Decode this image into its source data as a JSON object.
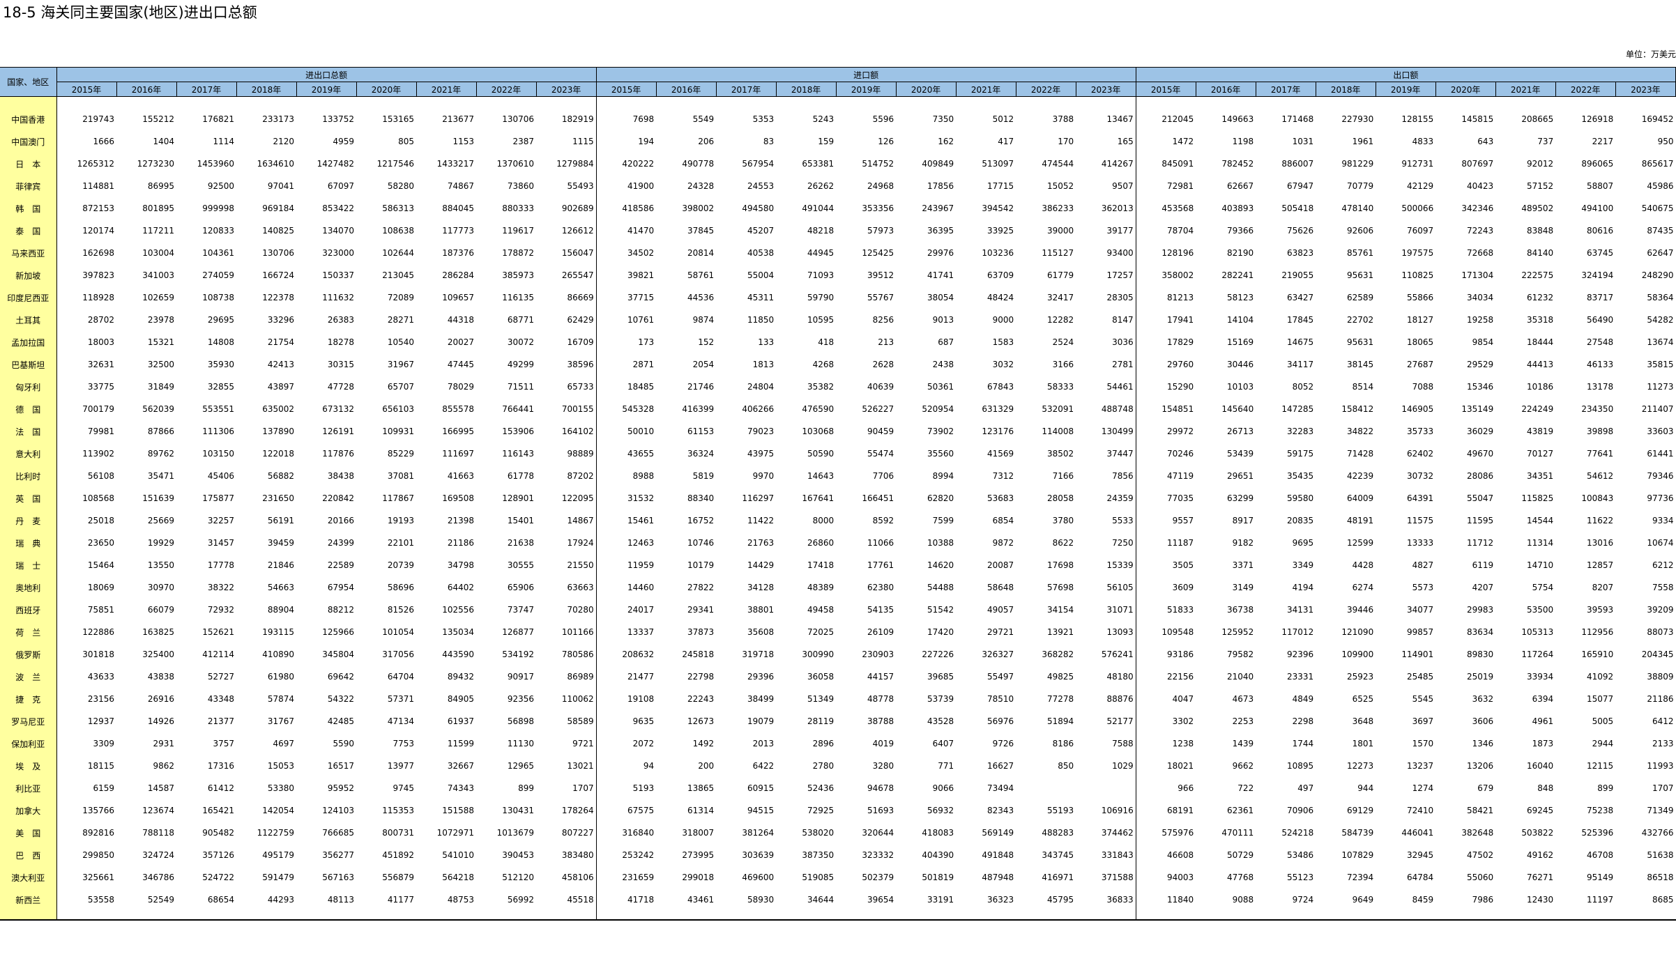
{
  "title": "18-5  海关同主要国家(地区)进出口总额",
  "unit": "单位：万美元",
  "header": {
    "row_label": "国家、地区",
    "groups": [
      "进出口总额",
      "进口额",
      "出口额"
    ],
    "years": [
      "2015年",
      "2016年",
      "2017年",
      "2018年",
      "2019年",
      "2020年",
      "2021年",
      "2022年",
      "2023年"
    ]
  },
  "rows": [
    {
      "name": "中国香港",
      "values": [
        "219743",
        "155212",
        "176821",
        "233173",
        "133752",
        "153165",
        "213677",
        "130706",
        "182919",
        "7698",
        "5549",
        "5353",
        "5243",
        "5596",
        "7350",
        "5012",
        "3788",
        "13467",
        "212045",
        "149663",
        "171468",
        "227930",
        "128155",
        "145815",
        "208665",
        "126918",
        "169452"
      ]
    },
    {
      "name": "中国澳门",
      "values": [
        "1666",
        "1404",
        "1114",
        "2120",
        "4959",
        "805",
        "1153",
        "2387",
        "1115",
        "194",
        "206",
        "83",
        "159",
        "126",
        "162",
        "417",
        "170",
        "165",
        "1472",
        "1198",
        "1031",
        "1961",
        "4833",
        "643",
        "737",
        "2217",
        "950"
      ]
    },
    {
      "name": "日　本",
      "values": [
        "1265312",
        "1273230",
        "1453960",
        "1634610",
        "1427482",
        "1217546",
        "1433217",
        "1370610",
        "1279884",
        "420222",
        "490778",
        "567954",
        "653381",
        "514752",
        "409849",
        "513097",
        "474544",
        "414267",
        "845091",
        "782452",
        "886007",
        "981229",
        "912731",
        "807697",
        "92012",
        "896065",
        "865617"
      ]
    },
    {
      "name": "菲律宾",
      "values": [
        "114881",
        "86995",
        "92500",
        "97041",
        "67097",
        "58280",
        "74867",
        "73860",
        "55493",
        "41900",
        "24328",
        "24553",
        "26262",
        "24968",
        "17856",
        "17715",
        "15052",
        "9507",
        "72981",
        "62667",
        "67947",
        "70779",
        "42129",
        "40423",
        "57152",
        "58807",
        "45986"
      ]
    },
    {
      "name": "韩　国",
      "values": [
        "872153",
        "801895",
        "999998",
        "969184",
        "853422",
        "586313",
        "884045",
        "880333",
        "902689",
        "418586",
        "398002",
        "494580",
        "491044",
        "353356",
        "243967",
        "394542",
        "386233",
        "362013",
        "453568",
        "403893",
        "505418",
        "478140",
        "500066",
        "342346",
        "489502",
        "494100",
        "540675"
      ]
    },
    {
      "name": "泰　国",
      "values": [
        "120174",
        "117211",
        "120833",
        "140825",
        "134070",
        "108638",
        "117773",
        "119617",
        "126612",
        "41470",
        "37845",
        "45207",
        "48218",
        "57973",
        "36395",
        "33925",
        "39000",
        "39177",
        "78704",
        "79366",
        "75626",
        "92606",
        "76097",
        "72243",
        "83848",
        "80616",
        "87435"
      ]
    },
    {
      "name": "马来西亚",
      "values": [
        "162698",
        "103004",
        "104361",
        "130706",
        "323000",
        "102644",
        "187376",
        "178872",
        "156047",
        "34502",
        "20814",
        "40538",
        "44945",
        "125425",
        "29976",
        "103236",
        "115127",
        "93400",
        "128196",
        "82190",
        "63823",
        "85761",
        "197575",
        "72668",
        "84140",
        "63745",
        "62647"
      ]
    },
    {
      "name": "新加坡",
      "values": [
        "397823",
        "341003",
        "274059",
        "166724",
        "150337",
        "213045",
        "286284",
        "385973",
        "265547",
        "39821",
        "58761",
        "55004",
        "71093",
        "39512",
        "41741",
        "63709",
        "61779",
        "17257",
        "358002",
        "282241",
        "219055",
        "95631",
        "110825",
        "171304",
        "222575",
        "324194",
        "248290"
      ]
    },
    {
      "name": "印度尼西亚",
      "values": [
        "118928",
        "102659",
        "108738",
        "122378",
        "111632",
        "72089",
        "109657",
        "116135",
        "86669",
        "37715",
        "44536",
        "45311",
        "59790",
        "55767",
        "38054",
        "48424",
        "32417",
        "28305",
        "81213",
        "58123",
        "63427",
        "62589",
        "55866",
        "34034",
        "61232",
        "83717",
        "58364"
      ]
    },
    {
      "name": "土耳其",
      "values": [
        "28702",
        "23978",
        "29695",
        "33296",
        "26383",
        "28271",
        "44318",
        "68771",
        "62429",
        "10761",
        "9874",
        "11850",
        "10595",
        "8256",
        "9013",
        "9000",
        "12282",
        "8147",
        "17941",
        "14104",
        "17845",
        "22702",
        "18127",
        "19258",
        "35318",
        "56490",
        "54282"
      ]
    },
    {
      "name": "孟加拉国",
      "values": [
        "18003",
        "15321",
        "14808",
        "21754",
        "18278",
        "10540",
        "20027",
        "30072",
        "16709",
        "173",
        "152",
        "133",
        "418",
        "213",
        "687",
        "1583",
        "2524",
        "3036",
        "17829",
        "15169",
        "14675",
        "95631",
        "18065",
        "9854",
        "18444",
        "27548",
        "13674"
      ]
    },
    {
      "name": "巴基斯坦",
      "values": [
        "32631",
        "32500",
        "35930",
        "42413",
        "30315",
        "31967",
        "47445",
        "49299",
        "38596",
        "2871",
        "2054",
        "1813",
        "4268",
        "2628",
        "2438",
        "3032",
        "3166",
        "2781",
        "29760",
        "30446",
        "34117",
        "38145",
        "27687",
        "29529",
        "44413",
        "46133",
        "35815"
      ]
    },
    {
      "name": "匈牙利",
      "values": [
        "33775",
        "31849",
        "32855",
        "43897",
        "47728",
        "65707",
        "78029",
        "71511",
        "65733",
        "18485",
        "21746",
        "24804",
        "35382",
        "40639",
        "50361",
        "67843",
        "58333",
        "54461",
        "15290",
        "10103",
        "8052",
        "8514",
        "7088",
        "15346",
        "10186",
        "13178",
        "11273"
      ]
    },
    {
      "name": "德　国",
      "values": [
        "700179",
        "562039",
        "553551",
        "635002",
        "673132",
        "656103",
        "855578",
        "766441",
        "700155",
        "545328",
        "416399",
        "406266",
        "476590",
        "526227",
        "520954",
        "631329",
        "532091",
        "488748",
        "154851",
        "145640",
        "147285",
        "158412",
        "146905",
        "135149",
        "224249",
        "234350",
        "211407"
      ]
    },
    {
      "name": "法　国",
      "values": [
        "79981",
        "87866",
        "111306",
        "137890",
        "126191",
        "109931",
        "166995",
        "153906",
        "164102",
        "50010",
        "61153",
        "79023",
        "103068",
        "90459",
        "73902",
        "123176",
        "114008",
        "130499",
        "29972",
        "26713",
        "32283",
        "34822",
        "35733",
        "36029",
        "43819",
        "39898",
        "33603"
      ]
    },
    {
      "name": "意大利",
      "values": [
        "113902",
        "89762",
        "103150",
        "122018",
        "117876",
        "85229",
        "111697",
        "116143",
        "98889",
        "43655",
        "36324",
        "43975",
        "50590",
        "55474",
        "35560",
        "41569",
        "38502",
        "37447",
        "70246",
        "53439",
        "59175",
        "71428",
        "62402",
        "49670",
        "70127",
        "77641",
        "61441"
      ]
    },
    {
      "name": "比利时",
      "values": [
        "56108",
        "35471",
        "45406",
        "56882",
        "38438",
        "37081",
        "41663",
        "61778",
        "87202",
        "8988",
        "5819",
        "9970",
        "14643",
        "7706",
        "8994",
        "7312",
        "7166",
        "7856",
        "47119",
        "29651",
        "35435",
        "42239",
        "30732",
        "28086",
        "34351",
        "54612",
        "79346"
      ]
    },
    {
      "name": "英　国",
      "values": [
        "108568",
        "151639",
        "175877",
        "231650",
        "220842",
        "117867",
        "169508",
        "128901",
        "122095",
        "31532",
        "88340",
        "116297",
        "167641",
        "166451",
        "62820",
        "53683",
        "28058",
        "24359",
        "77035",
        "63299",
        "59580",
        "64009",
        "64391",
        "55047",
        "115825",
        "100843",
        "97736"
      ]
    },
    {
      "name": "丹　麦",
      "values": [
        "25018",
        "25669",
        "32257",
        "56191",
        "20166",
        "19193",
        "21398",
        "15401",
        "14867",
        "15461",
        "16752",
        "11422",
        "8000",
        "8592",
        "7599",
        "6854",
        "3780",
        "5533",
        "9557",
        "8917",
        "20835",
        "48191",
        "11575",
        "11595",
        "14544",
        "11622",
        "9334"
      ]
    },
    {
      "name": "瑞　典",
      "values": [
        "23650",
        "19929",
        "31457",
        "39459",
        "24399",
        "22101",
        "21186",
        "21638",
        "17924",
        "12463",
        "10746",
        "21763",
        "26860",
        "11066",
        "10388",
        "9872",
        "8622",
        "7250",
        "11187",
        "9182",
        "9695",
        "12599",
        "13333",
        "11712",
        "11314",
        "13016",
        "10674"
      ]
    },
    {
      "name": "瑞　士",
      "values": [
        "15464",
        "13550",
        "17778",
        "21846",
        "22589",
        "20739",
        "34798",
        "30555",
        "21550",
        "11959",
        "10179",
        "14429",
        "17418",
        "17761",
        "14620",
        "20087",
        "17698",
        "15339",
        "3505",
        "3371",
        "3349",
        "4428",
        "4827",
        "6119",
        "14710",
        "12857",
        "6212"
      ]
    },
    {
      "name": "奥地利",
      "values": [
        "18069",
        "30970",
        "38322",
        "54663",
        "67954",
        "58696",
        "64402",
        "65906",
        "63663",
        "14460",
        "27822",
        "34128",
        "48389",
        "62380",
        "54488",
        "58648",
        "57698",
        "56105",
        "3609",
        "3149",
        "4194",
        "6274",
        "5573",
        "4207",
        "5754",
        "8207",
        "7558"
      ]
    },
    {
      "name": "西班牙",
      "values": [
        "75851",
        "66079",
        "72932",
        "88904",
        "88212",
        "81526",
        "102556",
        "73747",
        "70280",
        "24017",
        "29341",
        "38801",
        "49458",
        "54135",
        "51542",
        "49057",
        "34154",
        "31071",
        "51833",
        "36738",
        "34131",
        "39446",
        "34077",
        "29983",
        "53500",
        "39593",
        "39209"
      ]
    },
    {
      "name": "荷　兰",
      "values": [
        "122886",
        "163825",
        "152621",
        "193115",
        "125966",
        "101054",
        "135034",
        "126877",
        "101166",
        "13337",
        "37873",
        "35608",
        "72025",
        "26109",
        "17420",
        "29721",
        "13921",
        "13093",
        "109548",
        "125952",
        "117012",
        "121090",
        "99857",
        "83634",
        "105313",
        "112956",
        "88073"
      ]
    },
    {
      "name": "俄罗斯",
      "values": [
        "301818",
        "325400",
        "412114",
        "410890",
        "345804",
        "317056",
        "443590",
        "534192",
        "780586",
        "208632",
        "245818",
        "319718",
        "300990",
        "230903",
        "227226",
        "326327",
        "368282",
        "576241",
        "93186",
        "79582",
        "92396",
        "109900",
        "114901",
        "89830",
        "117264",
        "165910",
        "204345"
      ]
    },
    {
      "name": "波　兰",
      "values": [
        "43633",
        "43838",
        "52727",
        "61980",
        "69642",
        "64704",
        "89432",
        "90917",
        "86989",
        "21477",
        "22798",
        "29396",
        "36058",
        "44157",
        "39685",
        "55497",
        "49825",
        "48180",
        "22156",
        "21040",
        "23331",
        "25923",
        "25485",
        "25019",
        "33934",
        "41092",
        "38809"
      ]
    },
    {
      "name": "捷　克",
      "values": [
        "23156",
        "26916",
        "43348",
        "57874",
        "54322",
        "57371",
        "84905",
        "92356",
        "110062",
        "19108",
        "22243",
        "38499",
        "51349",
        "48778",
        "53739",
        "78510",
        "77278",
        "88876",
        "4047",
        "4673",
        "4849",
        "6525",
        "5545",
        "3632",
        "6394",
        "15077",
        "21186"
      ]
    },
    {
      "name": "罗马尼亚",
      "values": [
        "12937",
        "14926",
        "21377",
        "31767",
        "42485",
        "47134",
        "61937",
        "56898",
        "58589",
        "9635",
        "12673",
        "19079",
        "28119",
        "38788",
        "43528",
        "56976",
        "51894",
        "52177",
        "3302",
        "2253",
        "2298",
        "3648",
        "3697",
        "3606",
        "4961",
        "5005",
        "6412"
      ]
    },
    {
      "name": "保加利亚",
      "values": [
        "3309",
        "2931",
        "3757",
        "4697",
        "5590",
        "7753",
        "11599",
        "11130",
        "9721",
        "2072",
        "1492",
        "2013",
        "2896",
        "4019",
        "6407",
        "9726",
        "8186",
        "7588",
        "1238",
        "1439",
        "1744",
        "1801",
        "1570",
        "1346",
        "1873",
        "2944",
        "2133"
      ]
    },
    {
      "name": "埃　及",
      "values": [
        "18115",
        "9862",
        "17316",
        "15053",
        "16517",
        "13977",
        "32667",
        "12965",
        "13021",
        "94",
        "200",
        "6422",
        "2780",
        "3280",
        "771",
        "16627",
        "850",
        "1029",
        "18021",
        "9662",
        "10895",
        "12273",
        "13237",
        "13206",
        "16040",
        "12115",
        "11993"
      ]
    },
    {
      "name": "利比亚",
      "values": [
        "6159",
        "14587",
        "61412",
        "53380",
        "95952",
        "9745",
        "74343",
        "899",
        "1707",
        "5193",
        "13865",
        "60915",
        "52436",
        "94678",
        "9066",
        "73494",
        "",
        "",
        "966",
        "722",
        "497",
        "944",
        "1274",
        "679",
        "848",
        "899",
        "1707"
      ]
    },
    {
      "name": "加拿大",
      "values": [
        "135766",
        "123674",
        "165421",
        "142054",
        "124103",
        "115353",
        "151588",
        "130431",
        "178264",
        "67575",
        "61314",
        "94515",
        "72925",
        "51693",
        "56932",
        "82343",
        "55193",
        "106916",
        "68191",
        "62361",
        "70906",
        "69129",
        "72410",
        "58421",
        "69245",
        "75238",
        "71349"
      ]
    },
    {
      "name": "美　国",
      "values": [
        "892816",
        "788118",
        "905482",
        "1122759",
        "766685",
        "800731",
        "1072971",
        "1013679",
        "807227",
        "316840",
        "318007",
        "381264",
        "538020",
        "320644",
        "418083",
        "569149",
        "488283",
        "374462",
        "575976",
        "470111",
        "524218",
        "584739",
        "446041",
        "382648",
        "503822",
        "525396",
        "432766"
      ]
    },
    {
      "name": "巴　西",
      "values": [
        "299850",
        "324724",
        "357126",
        "495179",
        "356277",
        "451892",
        "541010",
        "390453",
        "383480",
        "253242",
        "273995",
        "303639",
        "387350",
        "323332",
        "404390",
        "491848",
        "343745",
        "331843",
        "46608",
        "50729",
        "53486",
        "107829",
        "32945",
        "47502",
        "49162",
        "46708",
        "51638"
      ]
    },
    {
      "name": "澳大利亚",
      "values": [
        "325661",
        "346786",
        "524722",
        "591479",
        "567163",
        "556879",
        "564218",
        "512120",
        "458106",
        "231659",
        "299018",
        "469600",
        "519085",
        "502379",
        "501819",
        "487948",
        "416971",
        "371588",
        "94003",
        "47768",
        "55123",
        "72394",
        "64784",
        "55060",
        "76271",
        "95149",
        "86518"
      ]
    },
    {
      "name": "新西兰",
      "values": [
        "53558",
        "52549",
        "68654",
        "44293",
        "48113",
        "41177",
        "48753",
        "56992",
        "45518",
        "41718",
        "43461",
        "58930",
        "34644",
        "39654",
        "33191",
        "36323",
        "45795",
        "36833",
        "11840",
        "9088",
        "9724",
        "9649",
        "8459",
        "7986",
        "12430",
        "11197",
        "8685"
      ]
    }
  ]
}
